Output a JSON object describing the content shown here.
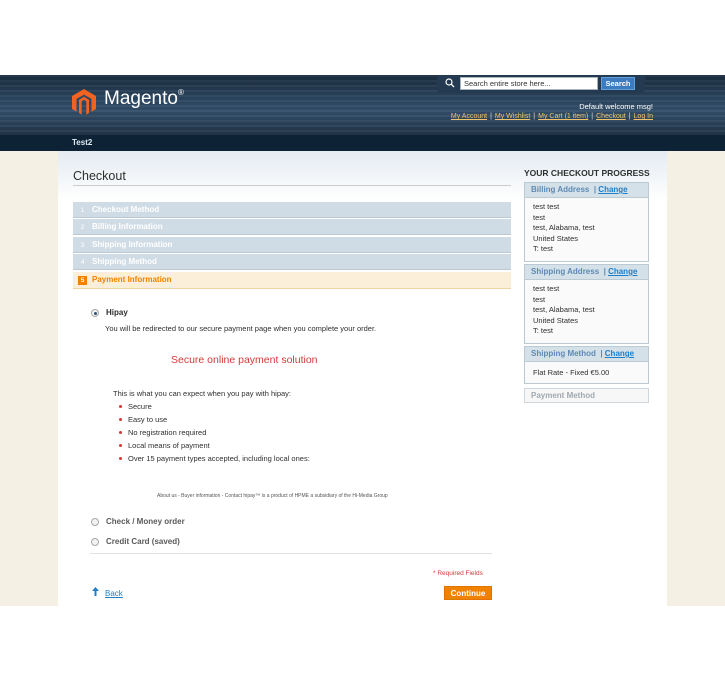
{
  "header": {
    "logo_text": "Magento",
    "logo_reg": "®",
    "search_placeholder": "Search entire store here...",
    "search_button": "Search",
    "welcome": "Default welcome msg!",
    "links": [
      "My Account",
      "My Wishlist",
      "My Cart (1 item)",
      "Checkout",
      "Log In"
    ]
  },
  "nav": {
    "item": "Test2"
  },
  "checkout": {
    "title": "Checkout",
    "steps": [
      {
        "num": "1",
        "label": "Checkout Method"
      },
      {
        "num": "2",
        "label": "Billing Information"
      },
      {
        "num": "3",
        "label": "Shipping Information"
      },
      {
        "num": "4",
        "label": "Shipping Method"
      }
    ],
    "active_step": {
      "num": "5",
      "label": "Payment Information"
    },
    "hipay": {
      "label": "Hipay",
      "redirect_text": "You will be redirected to our secure payment page when you complete your order.",
      "secure_text": "Secure online payment solution",
      "expect_text": "This is what you can expect when you pay with hipay:",
      "bullets": [
        "Secure",
        "Easy to use",
        "No registration required",
        "Local means of payment",
        "Over 15 payment types accepted, including local ones:"
      ],
      "footer_note": "About us - Buyer information - Contact     hipay™ is a product of HPME a subsidiary of the Hi-Media Group"
    },
    "other_options": [
      "Check / Money order",
      "Credit Card (saved)"
    ],
    "required_note": "* Required Fields",
    "back_label": "Back",
    "continue_label": "Continue"
  },
  "progress": {
    "title": "YOUR CHECKOUT PROGRESS",
    "change_label": "Change",
    "billing": {
      "heading": "Billing Address",
      "lines": [
        "test test",
        "test",
        "test, Alabama, test",
        "United States",
        "T: test"
      ]
    },
    "shipping": {
      "heading": "Shipping Address",
      "lines": [
        "test test",
        "test",
        "test, Alabama, test",
        "United States",
        "T: test"
      ]
    },
    "method": {
      "heading": "Shipping Method",
      "lines": [
        "Flat Rate - Fixed €5.00"
      ]
    },
    "payment": {
      "heading": "Payment Method"
    }
  },
  "colors": {
    "accent_orange": "#f18200",
    "link_blue": "#1e7ec8",
    "header_navy": "#213549",
    "step_blue": "#d0dce5"
  }
}
